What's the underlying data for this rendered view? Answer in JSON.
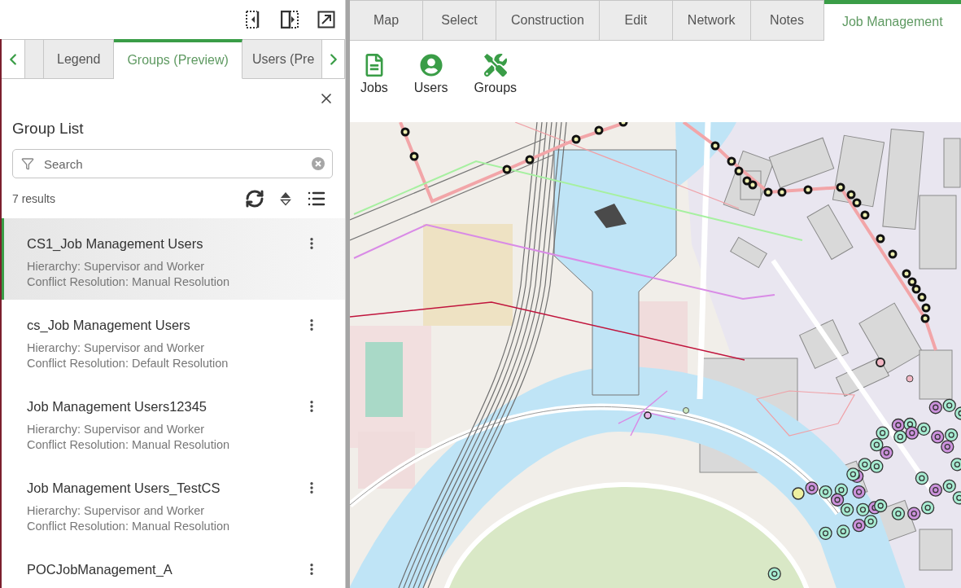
{
  "panel_tabs": [
    {
      "selected": false
    },
    {
      "label": "Legend",
      "selected": false
    },
    {
      "label": "Groups (Preview)",
      "selected": true
    },
    {
      "label": "Users (Pre",
      "selected": false
    }
  ],
  "group_list": {
    "title": "Group List",
    "search": {
      "placeholder": "Search"
    },
    "result_count": "7 results",
    "items": [
      {
        "name": "CS1_Job Management Users",
        "details": [
          "Hierarchy: Supervisor and Worker",
          "Conflict Resolution: Manual Resolution"
        ],
        "selected": true
      },
      {
        "name": "cs_Job Management Users",
        "details": [
          "Hierarchy: Supervisor and Worker",
          "Conflict Resolution: Default Resolution"
        ],
        "selected": false
      },
      {
        "name": "Job Management Users12345",
        "details": [
          "Hierarchy: Supervisor and Worker",
          "Conflict Resolution: Manual Resolution"
        ],
        "selected": false
      },
      {
        "name": "Job Management Users_TestCS",
        "details": [
          "Hierarchy: Supervisor and Worker",
          "Conflict Resolution: Manual Resolution"
        ],
        "selected": false
      },
      {
        "name": "POCJobManagement_A",
        "selected": false
      }
    ]
  },
  "ribbon_tabs": [
    {
      "label": "Map",
      "selected": false
    },
    {
      "label": "Select",
      "selected": false
    },
    {
      "label": "Construction",
      "selected": false
    },
    {
      "label": "Edit",
      "selected": false
    },
    {
      "label": "Network",
      "selected": false
    },
    {
      "label": "Notes",
      "selected": false
    },
    {
      "label": "Job Management",
      "selected": true
    }
  ],
  "ribbon_buttons": [
    {
      "label": "Jobs",
      "kind": "document"
    },
    {
      "label": "Users",
      "kind": "user"
    },
    {
      "label": "Groups",
      "kind": "tools"
    }
  ]
}
